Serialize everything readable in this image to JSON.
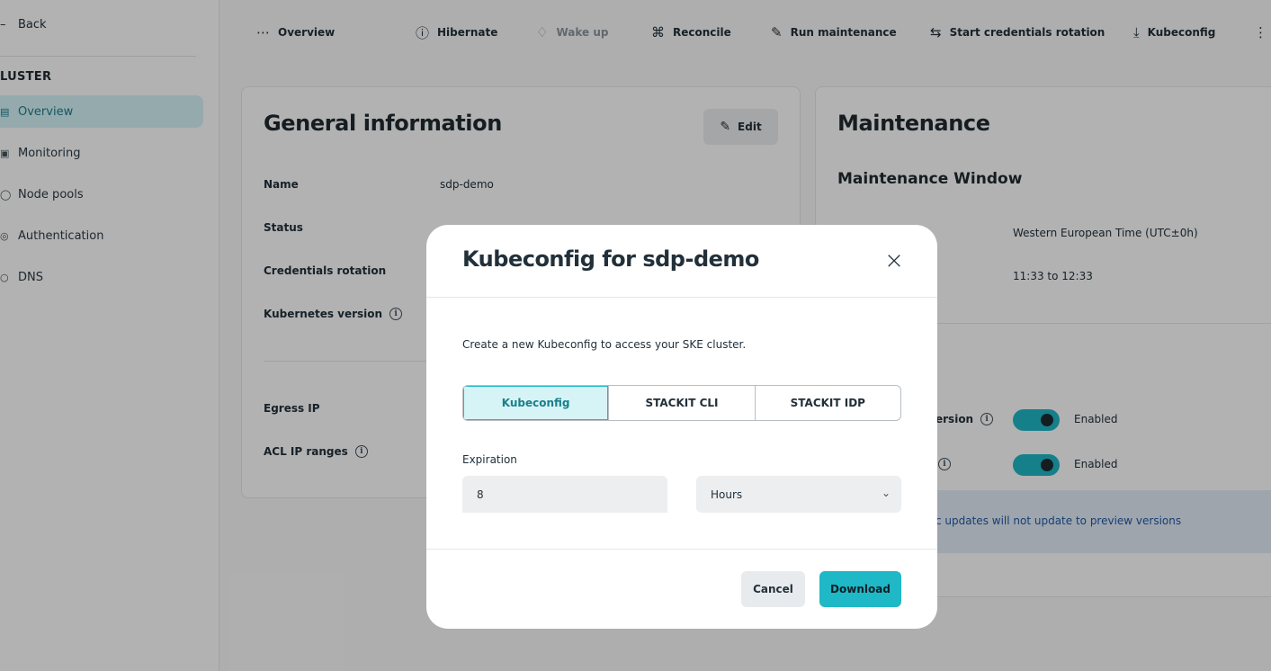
{
  "sidebar": {
    "back_label": "Back",
    "section_heading": "LUSTER",
    "items": [
      {
        "label": "Overview",
        "icon": "dashboard-icon",
        "active": true
      },
      {
        "label": "Monitoring",
        "icon": "monitor-icon",
        "active": false
      },
      {
        "label": "Node pools",
        "icon": "node-icon",
        "active": false
      },
      {
        "label": "Authentication",
        "icon": "fingerprint-icon",
        "active": false
      },
      {
        "label": "DNS",
        "icon": "globe-icon",
        "active": false
      }
    ]
  },
  "toolbar": {
    "items": [
      {
        "label": "Overview",
        "icon": "more-horizontal-icon",
        "disabled": false
      },
      {
        "label": "Hibernate",
        "icon": "info-circle-icon",
        "disabled": false
      },
      {
        "label": "Wake up",
        "icon": "bell-icon",
        "disabled": true
      },
      {
        "label": "Reconcile",
        "icon": "command-icon",
        "disabled": false
      },
      {
        "label": "Run maintenance",
        "icon": "wrench-icon",
        "disabled": false
      },
      {
        "label": "Start credentials rotation",
        "icon": "swap-icon",
        "disabled": false
      },
      {
        "label": "Kubeconfig",
        "icon": "download-icon",
        "disabled": false
      }
    ]
  },
  "general": {
    "title": "General information",
    "edit_label": "Edit",
    "fields": {
      "name_label": "Name",
      "name_value": "sdp-demo",
      "status_label": "Status",
      "credentials_label": "Credentials rotation",
      "k8s_label": "Kubernetes version",
      "egress_label": "Egress IP",
      "acl_label": "ACL IP ranges"
    }
  },
  "maintenance": {
    "title": "Maintenance",
    "subtitle": "Maintenance Window",
    "timezone": "Western European Time (UTC±0h)",
    "time_range": "11:33 to 12:33",
    "toggle1_partial_label": "ersion",
    "toggle1_state": "Enabled",
    "toggle2_state": "Enabled",
    "banner_text": "c updates will not update to preview versions"
  },
  "modal": {
    "title": "Kubeconfig for sdp-demo",
    "description": "Create a new Kubeconfig to access your SKE cluster.",
    "tabs": [
      "Kubeconfig",
      "STACKIT CLI",
      "STACKIT IDP"
    ],
    "selected_tab": "Kubeconfig",
    "expiration_label": "Expiration",
    "expiration_value": "8",
    "unit_value": "Hours",
    "cancel_label": "Cancel",
    "download_label": "Download"
  },
  "colors": {
    "accent": "#1fb8c6",
    "accent_light": "#d6f4f6",
    "text": "#22303a"
  }
}
